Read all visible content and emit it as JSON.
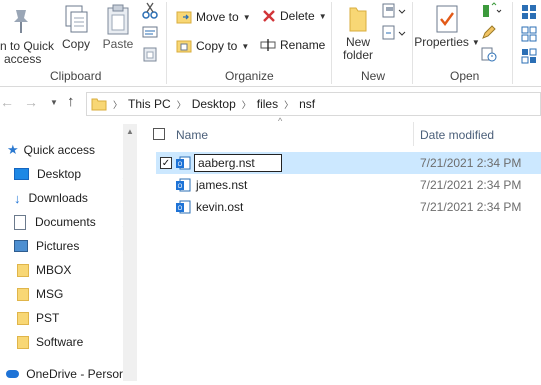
{
  "ribbon": {
    "clipboard": {
      "pin_label_line1": "n to Quick",
      "pin_label_line2": "access",
      "copy_label": "Copy",
      "paste_label": "Paste",
      "group_label": "Clipboard"
    },
    "organize": {
      "move_to": "Move to",
      "copy_to": "Copy to",
      "delete": "Delete",
      "rename": "Rename",
      "group_label": "Organize"
    },
    "new": {
      "new_folder_line1": "New",
      "new_folder_line2": "folder",
      "group_label": "New"
    },
    "open": {
      "properties": "Properties",
      "group_label": "Open"
    }
  },
  "address": {
    "crumbs": [
      "This PC",
      "Desktop",
      "files",
      "nsf"
    ]
  },
  "nav": {
    "items": [
      {
        "label": "Quick access",
        "icon": "star-icon"
      },
      {
        "label": "Desktop",
        "icon": "desktop-icon",
        "pinned": true
      },
      {
        "label": "Downloads",
        "icon": "download-icon",
        "pinned": true
      },
      {
        "label": "Documents",
        "icon": "documents-icon",
        "pinned": true
      },
      {
        "label": "Pictures",
        "icon": "pictures-icon",
        "pinned": true
      },
      {
        "label": "MBOX",
        "icon": "folder-icon"
      },
      {
        "label": "MSG",
        "icon": "folder-icon"
      },
      {
        "label": "PST",
        "icon": "folder-icon"
      },
      {
        "label": "Software",
        "icon": "folder-icon"
      },
      {
        "label": "OneDrive - Persor",
        "icon": "onedrive-icon"
      }
    ]
  },
  "files": {
    "header_name": "Name",
    "header_date": "Date modified",
    "rename_value": "aaberg.nst",
    "rows": [
      {
        "name": "aaberg.nst",
        "date": "7/21/2021 2:34 PM",
        "selected": true
      },
      {
        "name": "james.nst",
        "date": "7/21/2021 2:34 PM",
        "selected": false
      },
      {
        "name": "kevin.ost",
        "date": "7/21/2021 2:34 PM",
        "selected": false
      }
    ]
  },
  "colors": {
    "selection": "#cce8ff",
    "accent": "#0078d7",
    "folder": "#f8d775"
  }
}
